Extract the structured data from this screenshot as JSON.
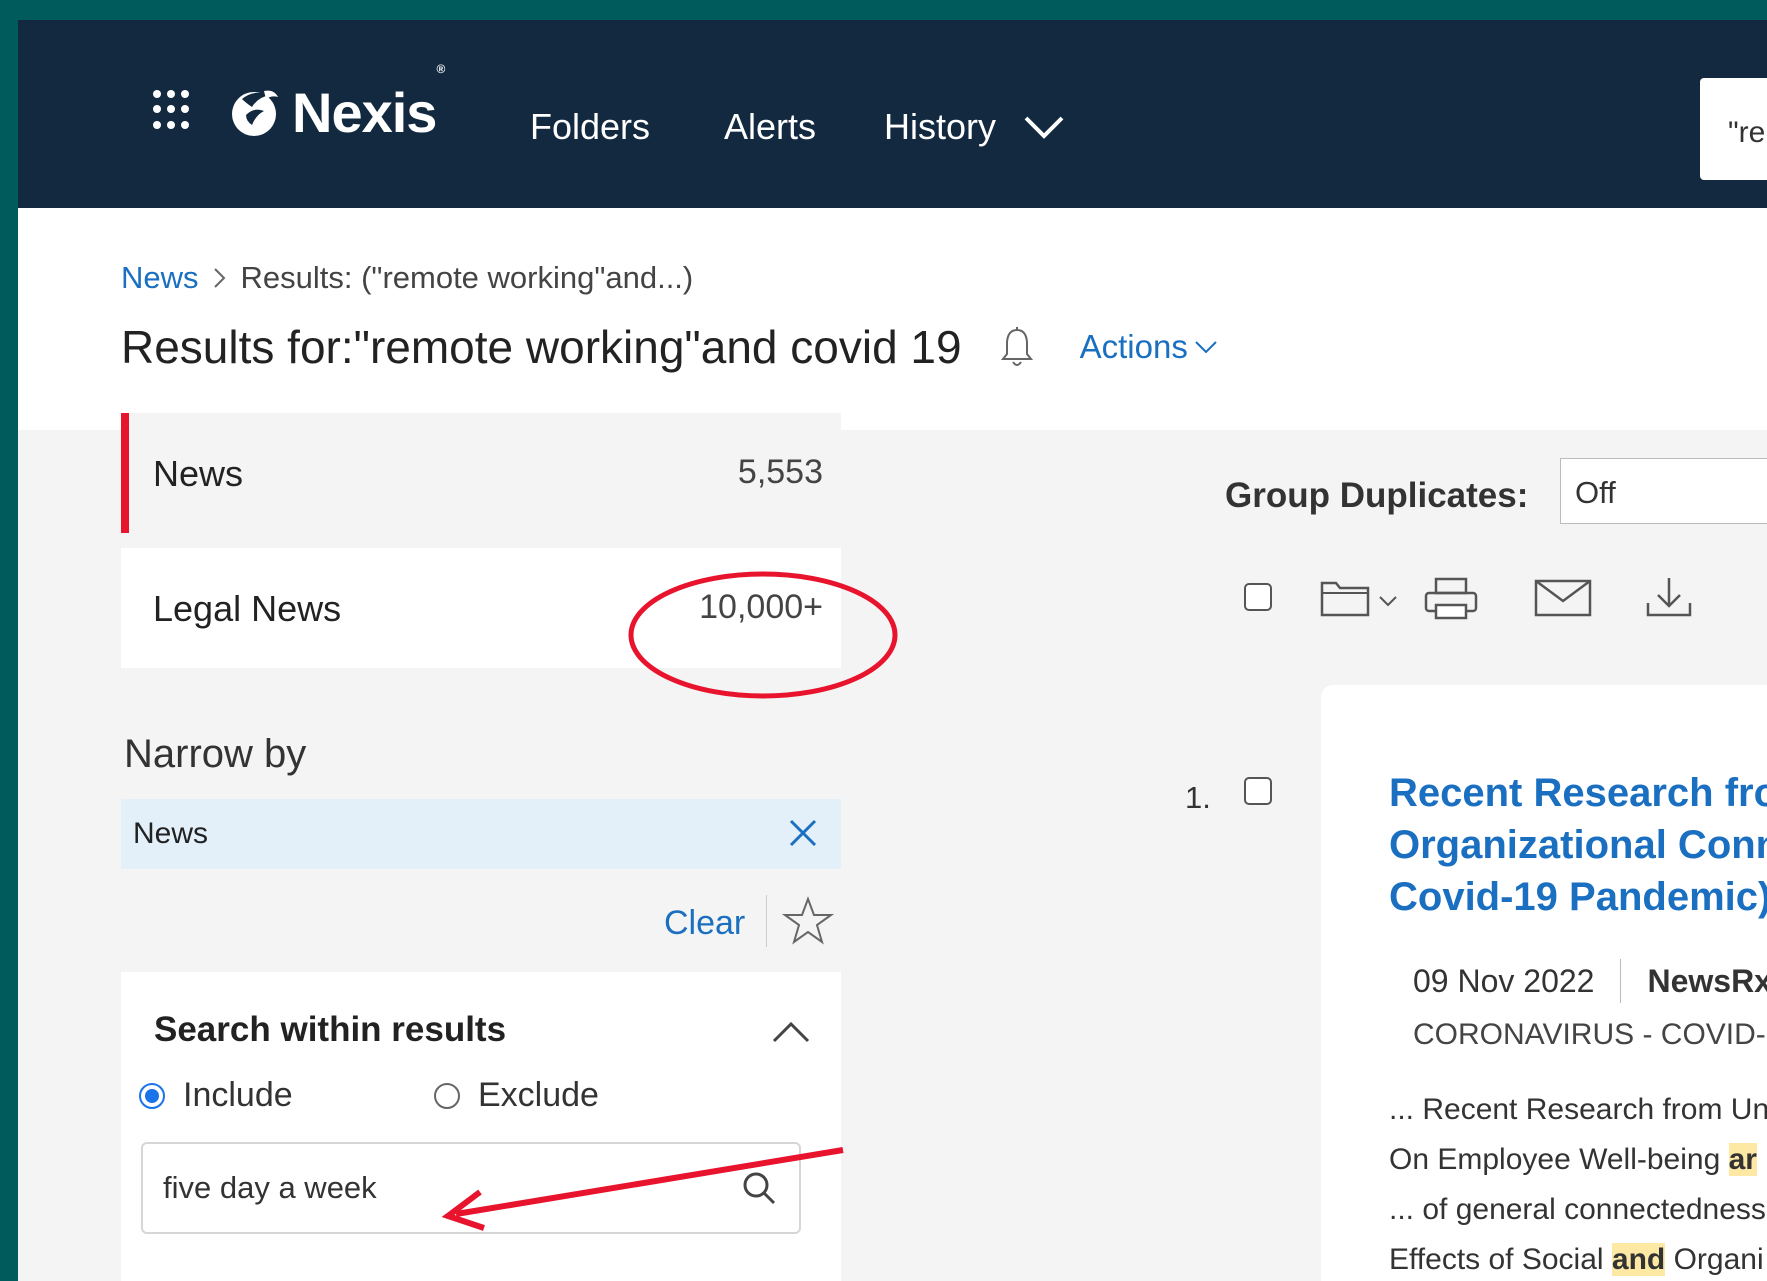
{
  "header": {
    "brand": "Nexis",
    "brand_mark": "®",
    "nav": {
      "folders": "Folders",
      "alerts": "Alerts",
      "history": "History"
    },
    "search_value": "\"rem"
  },
  "breadcrumb": {
    "root": "News",
    "current": "Results: (\"remote working\"and...)"
  },
  "title": {
    "text": "Results for:\"remote working\"and covid 19",
    "actions_label": "Actions"
  },
  "categories": [
    {
      "label": "News",
      "count": "5,553",
      "selected": true
    },
    {
      "label": "Legal News",
      "count": "10,000+",
      "selected": false
    }
  ],
  "narrow_by": {
    "heading": "Narrow by",
    "chip_label": "News",
    "clear_label": "Clear"
  },
  "search_within": {
    "title": "Search within results",
    "include_label": "Include",
    "exclude_label": "Exclude",
    "value": "five day a week"
  },
  "toolbar": {
    "group_duplicates_label": "Group Duplicates:",
    "group_duplicates_value": "Off"
  },
  "result": {
    "number": "1.",
    "title_lines": [
      "Recent Research fron",
      "Organizational Conn",
      "Covid-19 Pandemic)"
    ],
    "date": "09 Nov 2022",
    "source": "NewsRx",
    "topic": "CORONAVIRUS - COVID-",
    "snippet": {
      "line1": "... Recent Research from Un",
      "line2_pre": "On Employee Well-being ",
      "line2_hl": "ar",
      "line3": "... of general connectedness",
      "line4_pre": "Effects of Social ",
      "line4_hl": "and",
      "line4_post": " Organi"
    }
  },
  "colors": {
    "frame": "#005c5c",
    "header_bg": "#13293f",
    "link": "#1a6fc0",
    "accent_red": "#e8132c",
    "chip_bg": "#e3f0fa",
    "highlight": "#fde9a3"
  }
}
